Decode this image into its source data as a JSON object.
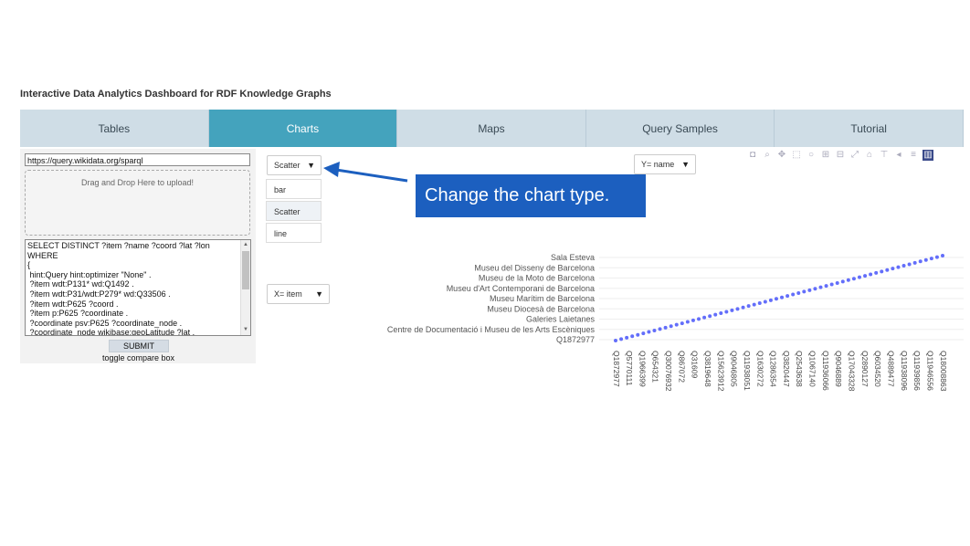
{
  "page_title": "Interactive Data Analytics Dashboard for RDF Knowledge Graphs",
  "tabs": [
    {
      "label": "Tables",
      "active": false
    },
    {
      "label": "Charts",
      "active": true
    },
    {
      "label": "Maps",
      "active": false
    },
    {
      "label": "Query Samples",
      "active": false
    },
    {
      "label": "Tutorial",
      "active": false
    }
  ],
  "left_panel": {
    "endpoint_url": "https://query.wikidata.org/sparql",
    "drop_zone_text": "Drag and Drop Here to upload!",
    "query_lines": [
      "SELECT DISTINCT ?item ?name ?coord ?lat ?lon",
      "WHERE",
      "{",
      " hint:Query hint:optimizer \"None\" .",
      " ?item wdt:P131* wd:Q1492 .",
      " ?item wdt:P31/wdt:P279* wd:Q33506 .",
      " ?item wdt:P625 ?coord .",
      " ?item p:P625 ?coordinate .",
      " ?coordinate psv:P625 ?coordinate_node .",
      " ?coordinate_node wikibase:geoLatitude ?lat ."
    ],
    "submit_label": "SUBMIT",
    "toggle_label": "toggle compare box"
  },
  "controls": {
    "chart_type_value": "Scatter",
    "chart_type_options": [
      "bar",
      "Scatter",
      "line"
    ],
    "x_select_value": "X= item",
    "y_select_value": "Y= name"
  },
  "annotation": {
    "text": "Change the chart type.",
    "color": "#1c5fbf"
  },
  "modebar_icons": [
    "camera-icon",
    "zoom-icon",
    "pan-icon",
    "box-select-icon",
    "lasso-icon",
    "zoom-in-icon",
    "zoom-out-icon",
    "autoscale-icon",
    "home-icon",
    "spike-lines-icon",
    "hover-closest-icon",
    "hover-compare-icon",
    "plotly-logo-icon"
  ],
  "colors": {
    "tab_bg": "#cfdde6",
    "tab_active": "#44a3bd",
    "marker": "#636efa"
  },
  "chart_data": {
    "type": "scatter",
    "title": "",
    "xlabel": "",
    "ylabel": "",
    "grid": true,
    "y_tick_labels": [
      "Q1872977",
      "Centre de Documentació i Museu de les Arts Escèniques",
      "Galeries Laietanes",
      "Museu Diocesà de Barcelona",
      "Museu Marítim de Barcelona",
      "Museu d'Art Contemporani de Barcelona",
      "Museu de la Moto de Barcelona",
      "Museu del Disseny de Barcelona",
      "Sala Esteva"
    ],
    "x_tick_labels": [
      "Q1872977",
      "Q5770111",
      "Q1966399",
      "Q654321",
      "Q30076932",
      "Q867072",
      "Q31609",
      "Q3819648",
      "Q15623912",
      "Q9046805",
      "Q11938051",
      "Q1630272",
      "Q1286354",
      "Q3820447",
      "Q2543638",
      "Q1067140",
      "Q11936066",
      "Q9046889",
      "Q17043328",
      "Q2890127",
      "Q6034520",
      "Q4889477",
      "Q11938096",
      "Q11939856",
      "Q11946556",
      "Q18008863"
    ],
    "point_count": 60
  }
}
